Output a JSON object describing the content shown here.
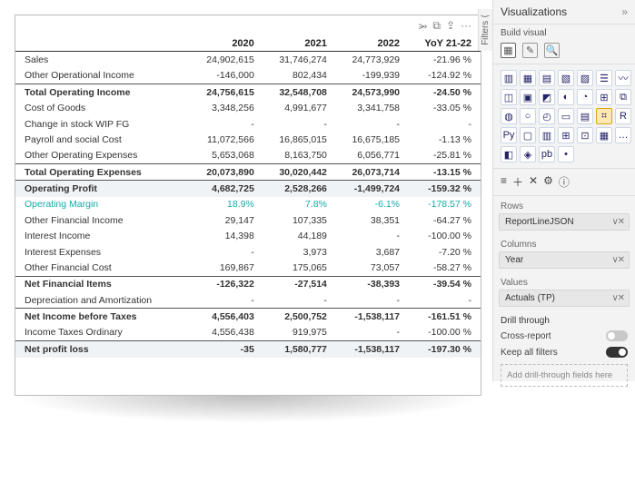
{
  "toolbar": {
    "filter": "⭃",
    "focus": "⧉",
    "export": "⇪",
    "more": "···"
  },
  "table": {
    "headers": [
      "",
      "2020",
      "2021",
      "2022",
      "YoY 21-22"
    ],
    "rows": [
      {
        "cells": [
          "Sales",
          "24,902,615",
          "31,746,274",
          "24,773,929",
          "-21.96 %"
        ]
      },
      {
        "cells": [
          "Other Operational Income",
          "-146,000",
          "802,434",
          "-199,939",
          "-124.92 %"
        ]
      },
      {
        "cells": [
          "Total Operating Income",
          "24,756,615",
          "32,548,708",
          "24,573,990",
          "-24.50 %"
        ],
        "bold": true
      },
      {
        "cells": [
          "Cost of Goods",
          "3,348,256",
          "4,991,677",
          "3,341,758",
          "-33.05 %"
        ]
      },
      {
        "cells": [
          "Change in stock WIP FG",
          "-",
          "-",
          "-",
          "-"
        ]
      },
      {
        "cells": [
          "Payroll and social Cost",
          "11,072,566",
          "16,865,015",
          "16,675,185",
          "-1.13 %"
        ]
      },
      {
        "cells": [
          "Other Operating Expenses",
          "5,653,068",
          "8,163,750",
          "6,056,771",
          "-25.81 %"
        ]
      },
      {
        "cells": [
          "Total Operating Expenses",
          "20,073,890",
          "30,020,442",
          "26,073,714",
          "-13.15 %"
        ],
        "bold": true
      },
      {
        "cells": [
          "Operating Profit",
          "4,682,725",
          "2,528,266",
          "-1,499,724",
          "-159.32 %"
        ],
        "bold": true,
        "shade": true
      },
      {
        "cells": [
          "Operating Margin",
          "18.9%",
          "7.8%",
          "-6.1%",
          "-178.57 %"
        ],
        "teal": true
      },
      {
        "cells": [
          "Other Financial Income",
          "29,147",
          "107,335",
          "38,351",
          "-64.27 %"
        ]
      },
      {
        "cells": [
          "Interest Income",
          "14,398",
          "44,189",
          "-",
          "-100.00 %"
        ]
      },
      {
        "cells": [
          "Interest Expenses",
          "-",
          "3,973",
          "3,687",
          "-7.20 %"
        ]
      },
      {
        "cells": [
          "Other Financial Cost",
          "169,867",
          "175,065",
          "73,057",
          "-58.27 %"
        ]
      },
      {
        "cells": [
          "Net Financial Items",
          "-126,322",
          "-27,514",
          "-38,393",
          "-39.54 %"
        ],
        "bold": true
      },
      {
        "cells": [
          "Depreciation and Amortization",
          "-",
          "-",
          "-",
          "-"
        ]
      },
      {
        "cells": [
          "Net Income before Taxes",
          "4,556,403",
          "2,500,752",
          "-1,538,117",
          "-161.51 %"
        ],
        "bold": true
      },
      {
        "cells": [
          "Income Taxes Ordinary",
          "4,556,438",
          "919,975",
          "-",
          "-100.00 %"
        ]
      },
      {
        "cells": [
          "Net profit loss",
          "-35",
          "1,580,777",
          "-1,538,117",
          "-197.30 %"
        ],
        "bold": true,
        "shade": true
      }
    ]
  },
  "filters_tab": "Filters",
  "viz_pane": {
    "title": "Visualizations",
    "build": "Build visual",
    "viz_icons": [
      "▥",
      "▦",
      "▤",
      "▧",
      "▨",
      "☰",
      "〰",
      "◫",
      "▣",
      "◩",
      "◐",
      "◔",
      "⊞",
      "⧉",
      "◍",
      "○",
      "◴",
      "▭",
      "▤",
      "⌗",
      "R",
      "Py",
      "▢",
      "▥",
      "⊞",
      "⊡",
      "▦",
      "…",
      "◧",
      "◈",
      "pb",
      "•"
    ],
    "tiny": [
      "≡",
      "＋",
      "✕",
      "⚙",
      "ⓘ"
    ],
    "section_rows": "Rows",
    "field_rows": "ReportLineJSON",
    "section_columns": "Columns",
    "field_columns": "Year",
    "section_values": "Values",
    "field_values": "Actuals (TP)",
    "drill": "Drill through",
    "cross": "Cross-report",
    "keep": "Keep all filters",
    "addfield": "Add drill-through fields here",
    "caret": "∨ ✕"
  }
}
